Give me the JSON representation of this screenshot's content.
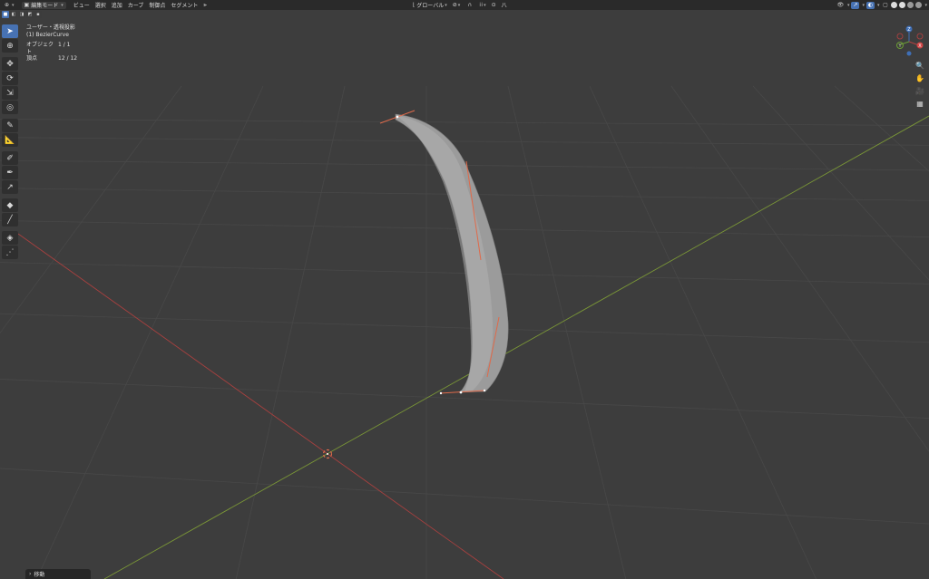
{
  "header": {
    "mode_label": "編集モード",
    "menus": [
      "ビュー",
      "選択",
      "追加",
      "カーブ",
      "制御点",
      "セグメント"
    ],
    "transform_orientation": "グローバル",
    "proportional_symbol": "八"
  },
  "viewport": {
    "view_name": "ユーザー・透視投影",
    "object_name": "(1) BezierCurve",
    "stats": [
      {
        "label": "オブジェクト",
        "value": "1 / 1"
      },
      {
        "label": "頂点",
        "value": "12 / 12"
      }
    ]
  },
  "gizmo": {
    "x": "X",
    "y": "Y",
    "z": "Z"
  },
  "last_operator": {
    "label": "移動"
  },
  "colors": {
    "x_axis": "#a8403f",
    "y_axis": "#7a9637",
    "handle": "#e06a4a",
    "active_tool": "#4772b3"
  }
}
